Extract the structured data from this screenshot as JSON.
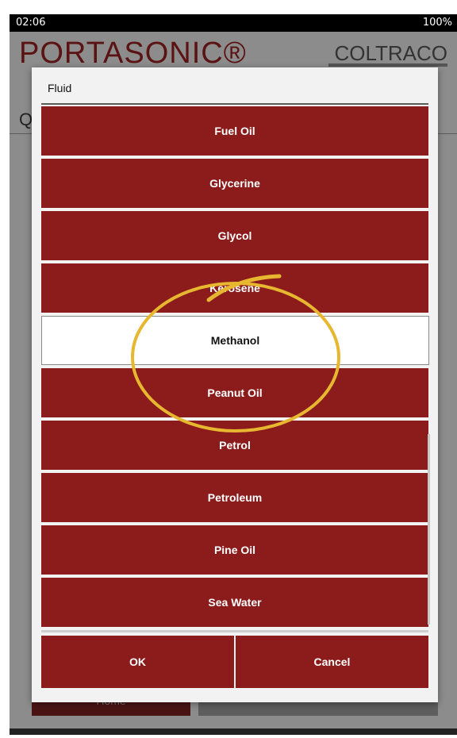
{
  "status_bar": {
    "time": "02:06",
    "battery": "100%"
  },
  "app_header": {
    "brand": "PORTASONIC®",
    "company": "COLTRACO"
  },
  "background": {
    "partial_heading": "Q",
    "home_button": "Home"
  },
  "dialog": {
    "title": "Fluid",
    "options": [
      "Fuel Oil",
      "Glycerine",
      "Glycol",
      "Kerosene",
      "Methanol",
      "Peanut Oil",
      "Petrol",
      "Petroleum",
      "Pine Oil",
      "Sea Water"
    ],
    "selected": "Methanol",
    "buttons": {
      "ok": "OK",
      "cancel": "Cancel"
    }
  },
  "colors": {
    "accent": "#8c1c1c",
    "annotation": "#e7b730"
  }
}
